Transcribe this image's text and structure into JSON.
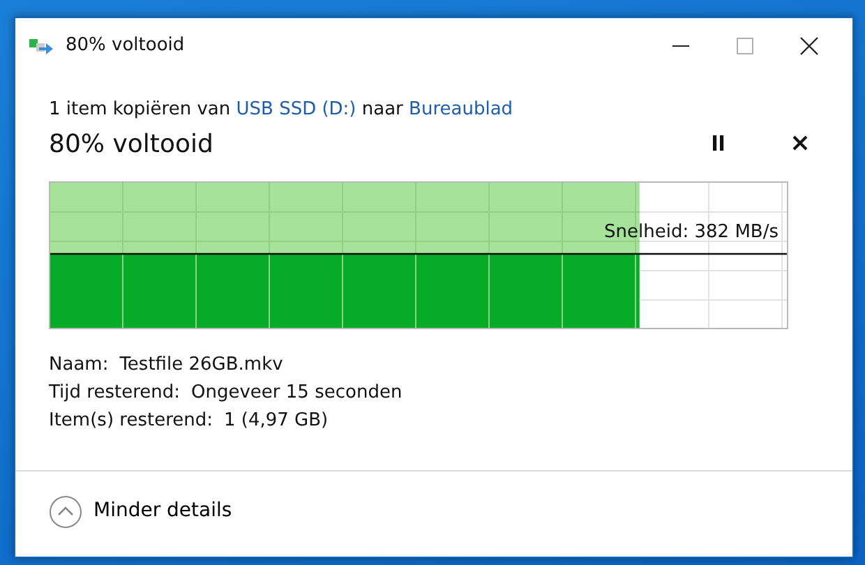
{
  "window": {
    "title": "80% voltooid",
    "controls": [
      {
        "kind": "minimize",
        "disabled": false
      },
      {
        "kind": "maximize",
        "disabled": true
      },
      {
        "kind": "close",
        "disabled": false
      }
    ]
  },
  "summary": [
    {
      "kind": "text",
      "text": "1 item kopiëren van "
    },
    {
      "kind": "link",
      "text": "USB SSD (D:)"
    },
    {
      "kind": "text",
      "text": " naar "
    },
    {
      "kind": "link",
      "text": "Bureaublad"
    }
  ],
  "progress": {
    "heading": "80% voltooid",
    "level": 0.8,
    "speed": "Snelheid: 382 MB/s"
  },
  "details": [
    {
      "label": "Naam:",
      "value": "Testfile 26GB.mkv"
    },
    {
      "label": "Tijd resterend:",
      "value": "Ongeveer 15 seconden"
    },
    {
      "label": "Item(s) resterend:",
      "value": "1 (4,97 GB)"
    }
  ],
  "footer": {
    "toggle": "Minder details",
    "expanded": true
  }
}
